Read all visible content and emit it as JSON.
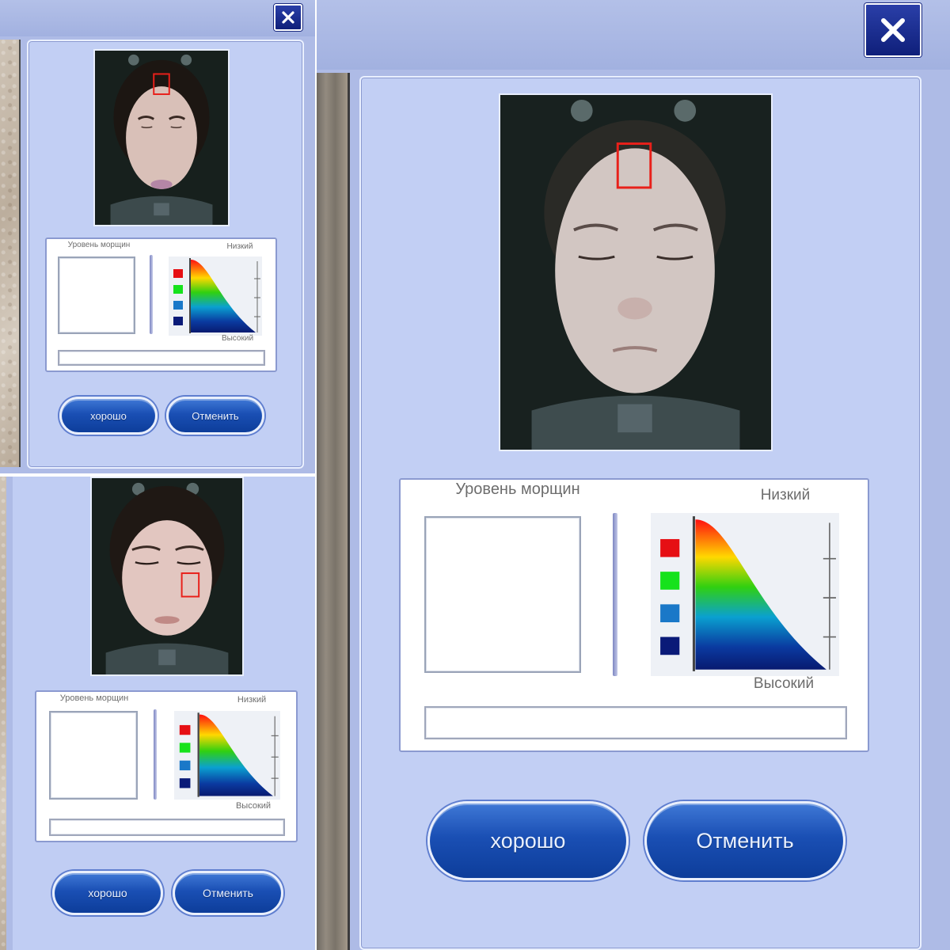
{
  "dialog": {
    "wrinkle_level_label": "Уровень морщин",
    "low_label": "Низкий",
    "high_label": "Высокий",
    "ok_label": "хорошо",
    "cancel_label": "Отменить",
    "close_icon": "close-icon",
    "scale_colors": [
      "#e60f14",
      "#16e21c",
      "#1a78c8",
      "#0a1a78"
    ]
  }
}
